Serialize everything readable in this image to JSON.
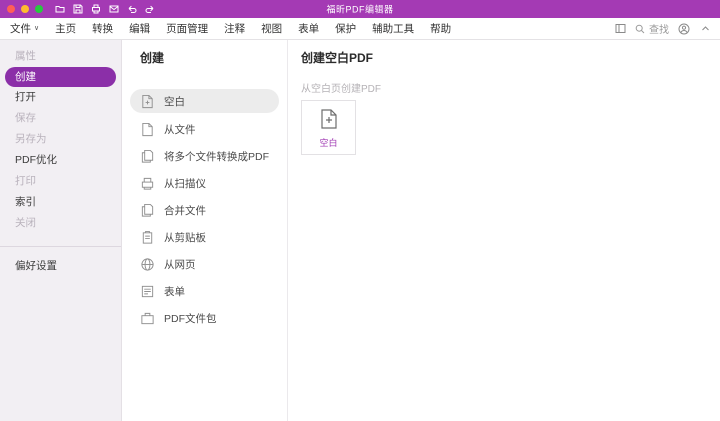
{
  "titlebar": {
    "title": "福昕PDF编辑器",
    "icons": [
      "folder-open-icon",
      "save-icon",
      "print-icon",
      "mail-icon",
      "undo-icon",
      "redo-icon"
    ]
  },
  "menu": {
    "items": [
      {
        "label": "文件"
      },
      {
        "label": "主页"
      },
      {
        "label": "转换"
      },
      {
        "label": "编辑"
      },
      {
        "label": "页面管理"
      },
      {
        "label": "注释"
      },
      {
        "label": "视图"
      },
      {
        "label": "表单"
      },
      {
        "label": "保护"
      },
      {
        "label": "辅助工具"
      },
      {
        "label": "帮助"
      }
    ],
    "file_dropdown_indicator": "∨",
    "search_label": "查找",
    "right_icons": [
      "layout-icon",
      "avatar-icon",
      "collapse-icon"
    ]
  },
  "sidebar": {
    "items": [
      {
        "label": "属性",
        "state": "disabled"
      },
      {
        "label": "创建",
        "state": "selected"
      },
      {
        "label": "打开",
        "state": "normal"
      },
      {
        "label": "保存",
        "state": "disabled"
      },
      {
        "label": "另存为",
        "state": "disabled"
      },
      {
        "label": "PDF优化",
        "state": "normal"
      },
      {
        "label": "打印",
        "state": "disabled"
      },
      {
        "label": "索引",
        "state": "normal"
      },
      {
        "label": "关闭",
        "state": "disabled"
      }
    ],
    "footer_label": "偏好设置"
  },
  "create_panel": {
    "title": "创建",
    "items": [
      {
        "label": "空白",
        "icon": "blank-page-icon",
        "selected": true
      },
      {
        "label": "从文件",
        "icon": "from-file-icon",
        "selected": false
      },
      {
        "label": "将多个文件转换成PDF",
        "icon": "multiple-files-icon",
        "selected": false
      },
      {
        "label": "从扫描仪",
        "icon": "scanner-icon",
        "selected": false
      },
      {
        "label": "合并文件",
        "icon": "combine-files-icon",
        "selected": false
      },
      {
        "label": "从剪贴板",
        "icon": "clipboard-icon",
        "selected": false
      },
      {
        "label": "从网页",
        "icon": "web-page-icon",
        "selected": false
      },
      {
        "label": "表单",
        "icon": "form-icon",
        "selected": false
      },
      {
        "label": "PDF文件包",
        "icon": "pdf-package-icon",
        "selected": false
      }
    ]
  },
  "content": {
    "title": "创建空白PDF",
    "subtitle": "从空白页创建PDF",
    "card": {
      "label": "空白"
    }
  },
  "colors": {
    "titlebar": "#a43ab4",
    "sidebar_selected": "#8b2fa8",
    "accent": "#a03ab3"
  }
}
